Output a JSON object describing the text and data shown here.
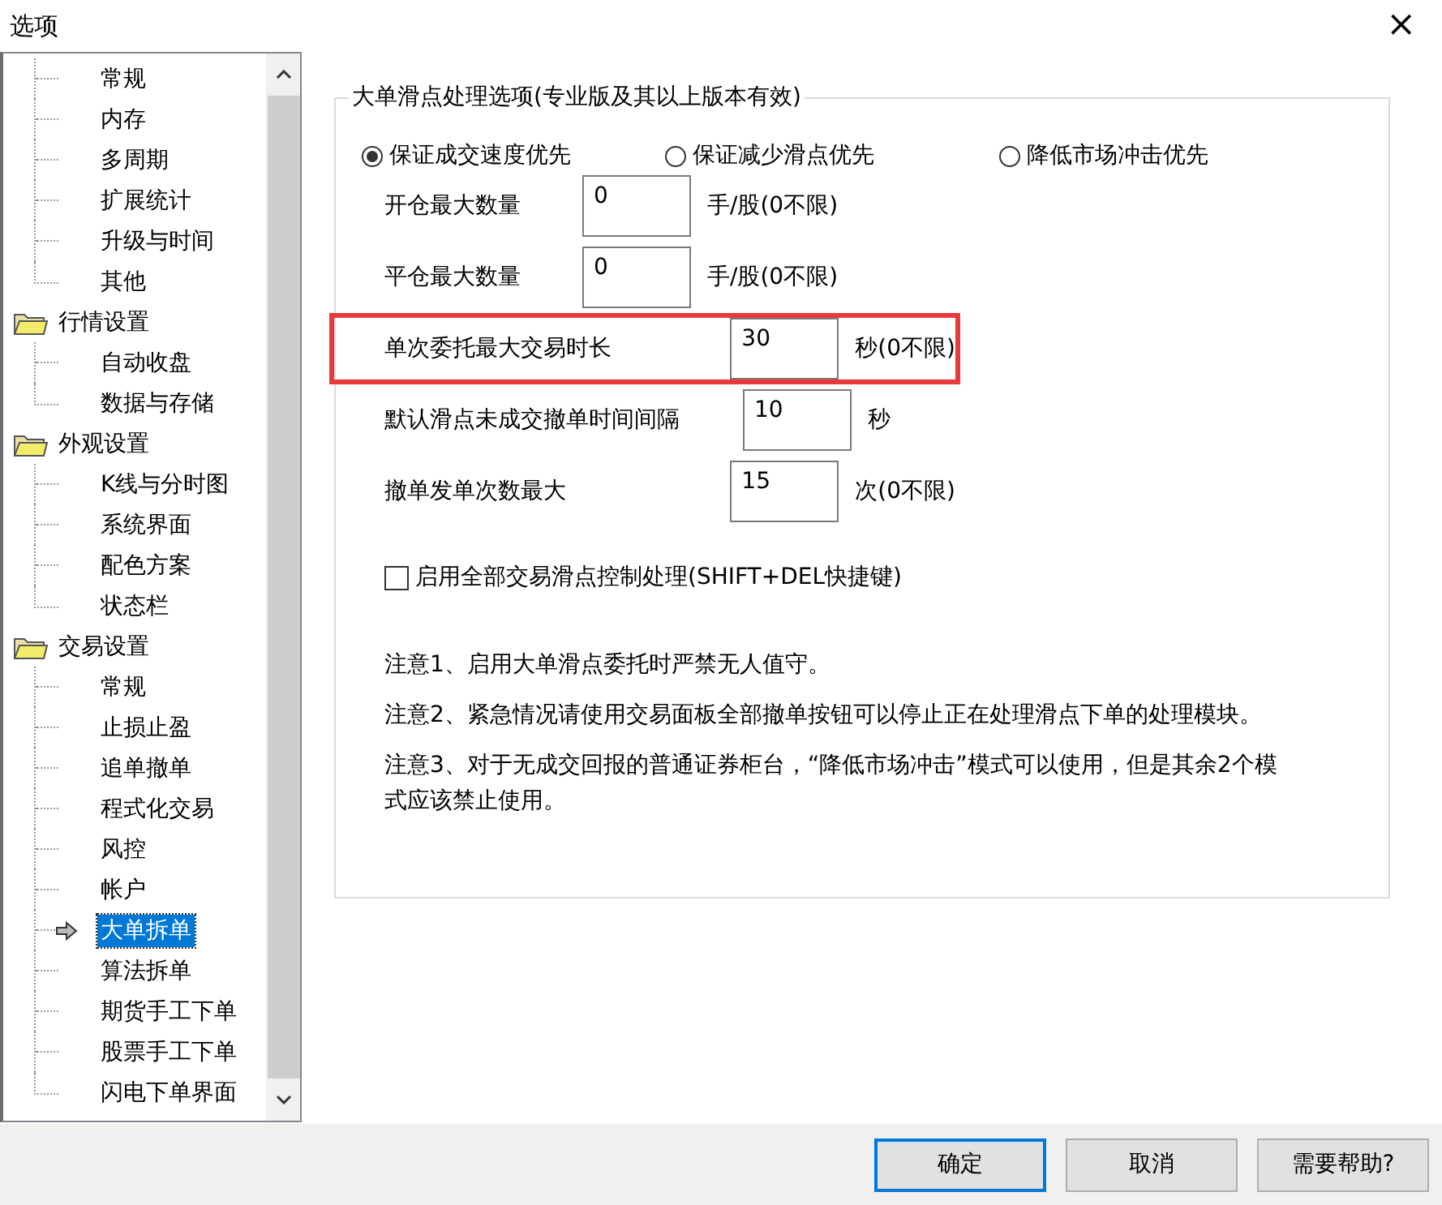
{
  "window": {
    "title": "选项",
    "close": "×"
  },
  "tree": [
    {
      "children": [
        {
          "label": "常规",
          "selected": false
        },
        {
          "label": "内存",
          "selected": false
        },
        {
          "label": "多周期",
          "selected": false
        },
        {
          "label": "扩展统计",
          "selected": false
        },
        {
          "label": "升级与时间",
          "selected": false
        },
        {
          "label": "其他",
          "selected": false
        }
      ]
    },
    {
      "label": "行情设置",
      "expanded": true,
      "children": [
        {
          "label": "自动收盘",
          "selected": false
        },
        {
          "label": "数据与存储",
          "selected": false
        }
      ]
    },
    {
      "label": "外观设置",
      "expanded": true,
      "children": [
        {
          "label": "K线与分时图",
          "selected": false
        },
        {
          "label": "系统界面",
          "selected": false
        },
        {
          "label": "配色方案",
          "selected": false
        },
        {
          "label": "状态栏",
          "selected": false
        }
      ]
    },
    {
      "label": "交易设置",
      "expanded": true,
      "children": [
        {
          "label": "常规",
          "selected": false
        },
        {
          "label": "止损止盈",
          "selected": false
        },
        {
          "label": "追单撤单",
          "selected": false
        },
        {
          "label": "程式化交易",
          "selected": false
        },
        {
          "label": "风控",
          "selected": false
        },
        {
          "label": "帐户",
          "selected": false
        },
        {
          "label": "大单拆单",
          "selected": true
        },
        {
          "label": "算法拆单",
          "selected": false
        },
        {
          "label": "期货手工下单",
          "selected": false
        },
        {
          "label": "股票手工下单",
          "selected": false
        },
        {
          "label": "闪电下单界面",
          "selected": false
        }
      ]
    }
  ],
  "group": {
    "title": "大单滑点处理选项(专业版及其以上版本有效)",
    "radios": [
      {
        "label": "保证成交速度优先",
        "selected": true
      },
      {
        "label": "保证减少滑点优先",
        "selected": false
      },
      {
        "label": "降低市场冲击优先",
        "selected": false
      }
    ],
    "quantity_fields": [
      {
        "label": "开仓最大数量",
        "value": "0",
        "unit": "手/股(0不限)",
        "highlighted": false
      },
      {
        "label": "平仓最大数量",
        "value": "0",
        "unit": "手/股(0不限)",
        "highlighted": false
      }
    ],
    "time_fields": [
      {
        "label": "单次委托最大交易时长",
        "value": "30",
        "unit": "秒(0不限)",
        "highlighted": true
      },
      {
        "label": "默认滑点未成交撤单时间间隔",
        "value": "10",
        "unit": "秒",
        "highlighted": false
      },
      {
        "label": "撤单发单次数最大",
        "value": "15",
        "unit": "次(0不限)",
        "highlighted": false
      }
    ],
    "checkbox": {
      "label": "启用全部交易滑点控制处理(SHIFT+DEL快捷键)",
      "checked": false
    },
    "notes": [
      "注意1、启用大单滑点委托时严禁无人值守。",
      "注意2、紧急情况请使用交易面板全部撤单按钮可以停止正在处理滑点下单的处理模块。",
      "注意3、对于无成交回报的普通证券柜台，“降低市场冲击”模式可以使用，但是其余2个模式应该禁止使用。"
    ]
  },
  "buttons": [
    {
      "label": "确定",
      "default": true
    },
    {
      "label": "取消",
      "default": false
    },
    {
      "label": "需要帮助?",
      "default": false
    }
  ]
}
